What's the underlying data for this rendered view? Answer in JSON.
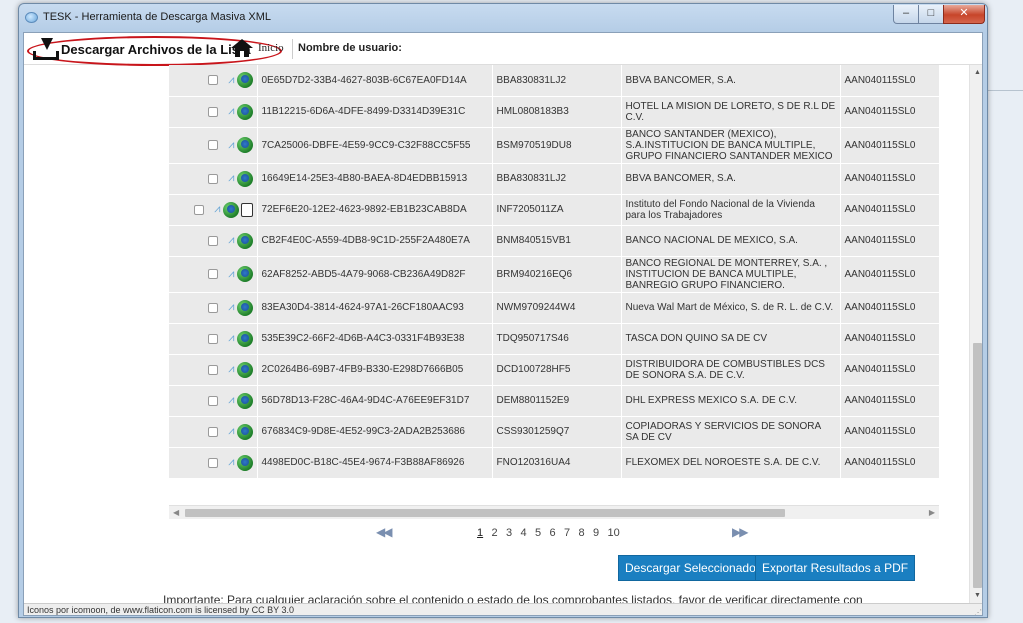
{
  "window": {
    "title": "TESK - Herramienta de Descarga Masiva XML",
    "controls": {
      "minimize": "–",
      "maximize": "□",
      "close": "✕"
    }
  },
  "toolbar": {
    "download_list_label": "Descargar Archivos de la Lista",
    "home_label": "Inicio",
    "user_label": "Nombre de usuario:"
  },
  "rows": [
    {
      "uuid": "0E65D7D2-33B4-4627-803B-6C67EA0FD14A",
      "rfc": "BBA830831LJ2",
      "name": "BBVA BANCOMER, S.A.",
      "receptor": "AAN040115SL0",
      "extra_icon": false
    },
    {
      "uuid": "11B12215-6D6A-4DFE-8499-D3314D39E31C",
      "rfc": "HML0808183B3",
      "name": "HOTEL LA MISION DE LORETO, S DE R.L DE C.V.",
      "receptor": "AAN040115SL0",
      "extra_icon": false
    },
    {
      "uuid": "7CA25006-DBFE-4E59-9CC9-C32F88CC5F55",
      "rfc": "BSM970519DU8",
      "name": "BANCO SANTANDER (MEXICO), S.A.INSTITUCION DE BANCA MULTIPLE, GRUPO FINANCIERO SANTANDER MEXICO",
      "receptor": "AAN040115SL0",
      "extra_icon": false
    },
    {
      "uuid": "16649E14-25E3-4B80-BAEA-8D4EDBB15913",
      "rfc": "BBA830831LJ2",
      "name": "BBVA BANCOMER, S.A.",
      "receptor": "AAN040115SL0",
      "extra_icon": false
    },
    {
      "uuid": "72EF6E20-12E2-4623-9892-EB1B23CAB8DA",
      "rfc": "INF7205011ZA",
      "name": "Instituto del Fondo Nacional de la Vivienda para los Trabajadores",
      "receptor": "AAN040115SL0",
      "extra_icon": true
    },
    {
      "uuid": "CB2F4E0C-A559-4DB8-9C1D-255F2A480E7A",
      "rfc": "BNM840515VB1",
      "name": "BANCO NACIONAL DE MEXICO, S.A.",
      "receptor": "AAN040115SL0",
      "extra_icon": false
    },
    {
      "uuid": "62AF8252-ABD5-4A79-9068-CB236A49D82F",
      "rfc": "BRM940216EQ6",
      "name": "BANCO REGIONAL DE MONTERREY, S.A. , INSTITUCION DE BANCA MULTIPLE, BANREGIO GRUPO FINANCIERO.",
      "receptor": "AAN040115SL0",
      "extra_icon": false
    },
    {
      "uuid": "83EA30D4-3814-4624-97A1-26CF180AAC93",
      "rfc": "NWM9709244W4",
      "name": "Nueva Wal Mart de México, S. de R. L. de C.V.",
      "receptor": "AAN040115SL0",
      "extra_icon": false
    },
    {
      "uuid": "535E39C2-66F2-4D6B-A4C3-0331F4B93E38",
      "rfc": "TDQ950717S46",
      "name": "TASCA DON QUINO SA DE CV",
      "receptor": "AAN040115SL0",
      "extra_icon": false
    },
    {
      "uuid": "2C0264B6-69B7-4FB9-B330-E298D7666B05",
      "rfc": "DCD100728HF5",
      "name": "DISTRIBUIDORA DE COMBUSTIBLES DCS DE SONORA S.A. DE C.V.",
      "receptor": "AAN040115SL0",
      "extra_icon": false
    },
    {
      "uuid": "56D78D13-F28C-46A4-9D4C-A76EE9EF31D7",
      "rfc": "DEM8801152E9",
      "name": "DHL EXPRESS MEXICO S.A. DE C.V.",
      "receptor": "AAN040115SL0",
      "extra_icon": false
    },
    {
      "uuid": "676834C9-9D8E-4E52-99C3-2ADA2B253686",
      "rfc": "CSS9301259Q7",
      "name": "COPIADORAS Y SERVICIOS DE SONORA SA DE CV",
      "receptor": "AAN040115SL0",
      "extra_icon": false
    },
    {
      "uuid": "4498ED0C-B18C-45E4-9674-F3B88AF86926",
      "rfc": "FNO120316UA4",
      "name": "FLEXOMEX DEL NOROESTE S.A. DE C.V.",
      "receptor": "AAN040115SL0",
      "extra_icon": false
    }
  ],
  "pager": {
    "first_label": "◀◀",
    "last_label": "▶▶",
    "pages": [
      "1",
      "2",
      "3",
      "4",
      "5",
      "6",
      "7",
      "8",
      "9",
      "10"
    ],
    "current": "1"
  },
  "actions": {
    "download_selected": "Descargar Seleccionados",
    "export_pdf": "Exportar Resultados a PDF"
  },
  "note": "Importante: Para cualquier aclaración sobre el contenido o estado de los comprobantes listados, favor de verificar directamente con",
  "status": "Iconos por icomoon, de www.flaticon.com is licensed by CC BY 3.0",
  "colors": {
    "accent_button": "#1a7fc1",
    "highlight_oval": "#c8151b",
    "row_bg": "#eaeaea"
  }
}
